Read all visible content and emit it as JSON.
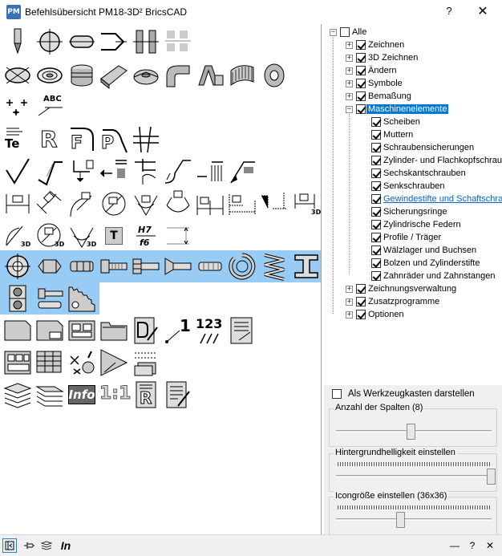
{
  "window": {
    "title": "Befehlsübersicht  PM18-3D²  BricsCAD",
    "icon": "PM",
    "help_label": "?",
    "close_label": "✕"
  },
  "icon_panel": {
    "texts": {
      "abc": "ABC",
      "te": "Te",
      "r": "R",
      "f": "F",
      "p": "P",
      "t": "T",
      "dim3d": "3D",
      "h7": "H7",
      "f6": "f6",
      "num1": "1",
      "num123": "123",
      "info": "Info",
      "scale": "1:1",
      "r2": "R"
    }
  },
  "tree": {
    "root": {
      "label": "Alle",
      "checked": false
    },
    "items": [
      {
        "label": "Zeichnen",
        "checked": true
      },
      {
        "label": "3D Zeichnen",
        "checked": true
      },
      {
        "label": "Ändern",
        "checked": true
      },
      {
        "label": "Symbole",
        "checked": true
      },
      {
        "label": "Bemaßung",
        "checked": true
      },
      {
        "label": "Maschinenelemente",
        "checked": true
      }
    ],
    "children": [
      {
        "label": "Scheiben"
      },
      {
        "label": "Muttern"
      },
      {
        "label": "Schraubensicherungen"
      },
      {
        "label": "Zylinder- und Flachkopfschrauben"
      },
      {
        "label": "Sechskantschrauben"
      },
      {
        "label": "Senkschrauben"
      },
      {
        "label": "Gewindestifte und Schaftschrauben"
      },
      {
        "label": "Sicherungsringe"
      },
      {
        "label": "Zylindrische Federn"
      },
      {
        "label": "Profile / Träger"
      },
      {
        "label": "Wälzlager und Buchsen"
      },
      {
        "label": "Bolzen und Zylinderstifte"
      },
      {
        "label": "Zahnräder und Zahnstangen"
      }
    ],
    "after": [
      {
        "label": "Zeichnungsverwaltung",
        "checked": true
      },
      {
        "label": "Zusatzprogramme",
        "checked": true
      },
      {
        "label": "Optionen",
        "checked": true
      }
    ]
  },
  "settings": {
    "toolbox_label": "Als Werkzeugkasten darstellen",
    "columns_label": "Anzahl der Spalten (8)",
    "columns_value": 8,
    "brightness_label": "Hintergrundhelligkeit einstellen",
    "brightness_value": 1.0,
    "iconsize_label": "Icongröße einstellen  (36x36)",
    "iconsize_value": 0.4
  },
  "statusbar": {
    "pin_icon": "pin-icon",
    "layers_icon": "layers-icon",
    "in_label": "In",
    "minus_label": "—",
    "help_label": "?",
    "close_label": "✕"
  },
  "colors": {
    "highlight": "#99ccf4",
    "selected": "#0078d7",
    "link": "#0066cc"
  }
}
